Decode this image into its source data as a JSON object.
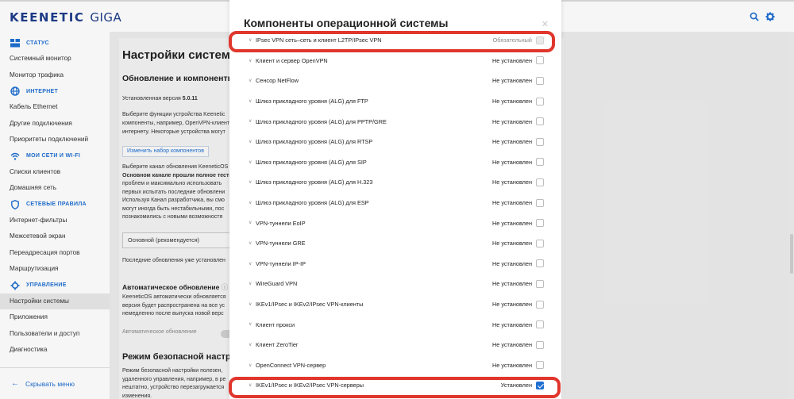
{
  "app": {
    "brand": "KEENETIC",
    "brand_model": "GIGA",
    "search_icon": "search-icon",
    "settings_icon": "gear-icon"
  },
  "sidebar": {
    "sections": [
      {
        "label": "Статус",
        "icon": "status-icon",
        "items": [
          "Системный монитор",
          "Монитор трафика"
        ]
      },
      {
        "label": "Интернет",
        "icon": "globe-icon",
        "items": [
          "Кабель Ethernet",
          "Другие подключения",
          "Приоритеты подключений"
        ]
      },
      {
        "label": "Мои сети и Wi-Fi",
        "icon": "wifi-icon",
        "items": [
          "Списки клиентов",
          "Домашняя сеть"
        ]
      },
      {
        "label": "Сетевые правила",
        "icon": "shield-icon",
        "items": [
          "Интернет-фильтры",
          "Межсетевой экран",
          "Переадресация портов",
          "Маршрутизация"
        ]
      },
      {
        "label": "Управление",
        "icon": "gear-icon",
        "items": [
          "Настройки системы",
          "Приложения",
          "Пользователи и доступ",
          "Диагностика"
        ]
      }
    ],
    "active_item": "Настройки системы",
    "hide_menu": "Скрывать меню"
  },
  "background": {
    "title": "Настройки системы",
    "subtitle": "Обновление и компоненты",
    "installed_version_label": "Установленная версия",
    "installed_version": "5.0.11",
    "desc1": [
      "Выберите функции устройства Keenetic",
      "компоненты, например, OpenVPN-клиент",
      "интернету. Некоторые устройства могут"
    ],
    "change_components_button": "Изменить набор компонентов",
    "desc2": [
      "Выберите канал обновления KeeneticOS",
      "Основном канале прошли полное тести",
      "проблем и максимально использовать",
      "первых испытать последние обновлени",
      "Используя Канал разработчика, вы смо",
      "могут иногда быть нестабильными, пос",
      "познакомились с новыми возможностя"
    ],
    "channel_select": "Основной (рекомендуется)",
    "last_updates": "Последние обновления уже установлен",
    "auto_update_title": "Автоматическое обновление",
    "auto_update_desc": [
      "KeeneticOS автоматически обновляется",
      "версия будет распространена на все ус",
      "немедленно после выпуска новой верс"
    ],
    "auto_update_toggle_label": "Автоматическое обновление",
    "safe_mode_title": "Режим безопасной настрой",
    "safe_mode_desc": [
      "Режим безопасной настройки полезен,",
      "удаленного управления, например, в ре",
      "нештатно, устройство перезагружается",
      "изменения."
    ]
  },
  "modal": {
    "title": "Компоненты операционной системы",
    "close_icon": "close-icon",
    "components": [
      {
        "name": "IPsec VPN сеть–сеть и клиент L2TP/IPsec VPN",
        "status": "Обязательный",
        "state": "disabled"
      },
      {
        "name": "Клиент и сервер OpenVPN",
        "status": "Не установлен",
        "state": "unchecked"
      },
      {
        "name": "Сенсор NetFlow",
        "status": "Не установлен",
        "state": "unchecked"
      },
      {
        "name": "Шлюз прикладного уровня (ALG) для FTP",
        "status": "Не установлен",
        "state": "unchecked"
      },
      {
        "name": "Шлюз прикладного уровня (ALG) для PPTP/GRE",
        "status": "Не установлен",
        "state": "unchecked"
      },
      {
        "name": "Шлюз прикладного уровня (ALG) для RTSP",
        "status": "Не установлен",
        "state": "unchecked"
      },
      {
        "name": "Шлюз прикладного уровня (ALG) для SIP",
        "status": "Не установлен",
        "state": "unchecked"
      },
      {
        "name": "Шлюз прикладного уровня (ALG) для H.323",
        "status": "Не установлен",
        "state": "unchecked"
      },
      {
        "name": "Шлюз прикладного уровня (ALG) для ESP",
        "status": "Не установлен",
        "state": "unchecked"
      },
      {
        "name": "VPN-туннели EoIP",
        "status": "Не установлен",
        "state": "unchecked"
      },
      {
        "name": "VPN-туннели GRE",
        "status": "Не установлен",
        "state": "unchecked"
      },
      {
        "name": "VPN-туннели IP-IP",
        "status": "Не установлен",
        "state": "unchecked"
      },
      {
        "name": "WireGuard VPN",
        "status": "Не установлен",
        "state": "unchecked"
      },
      {
        "name": "IKEv1/IPsec и IKEv2/IPsec VPN-клиенты",
        "status": "Не установлен",
        "state": "unchecked"
      },
      {
        "name": "Клиент прокси",
        "status": "Не установлен",
        "state": "unchecked"
      },
      {
        "name": "Клиент ZeroTier",
        "status": "Не установлен",
        "state": "unchecked"
      },
      {
        "name": "OpenConnect VPN-сервер",
        "status": "Не установлен",
        "state": "unchecked"
      },
      {
        "name": "IKEv1/IPsec и IKEv2/IPsec VPN-серверы",
        "status": "Установлен",
        "state": "checked"
      }
    ]
  },
  "colors": {
    "accent": "#1f6fd1",
    "brand": "#1f3e8a",
    "highlight": "#e0362c"
  }
}
